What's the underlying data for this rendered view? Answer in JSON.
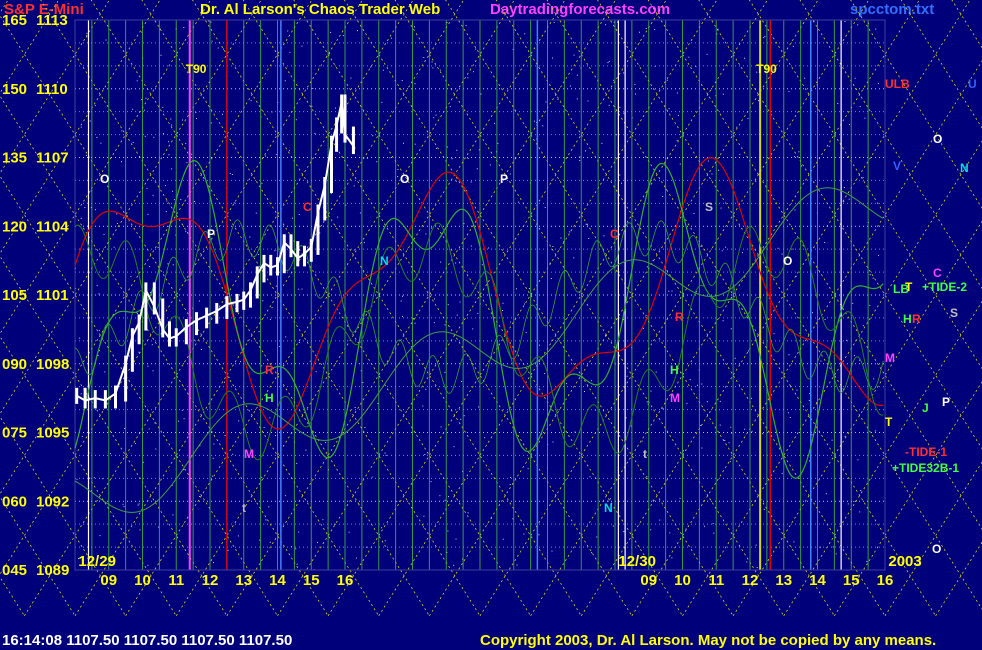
{
  "header": {
    "left_title": "S&P E-Mini",
    "center_title": "Dr. Al Larson's Chaos Trader Web",
    "site": "Daytradingforecasts.com",
    "filename": "spcctom.txt"
  },
  "footer": {
    "quote": "16:14:08  1107.50 1107.50 1107.50 1107.50",
    "copyright": "Copyright 2003, Dr. Al Larson. May not be copied by any means."
  },
  "colors": {
    "background": "#00007a",
    "axis_labels": "#ffff00",
    "price_bars": "#ffffff",
    "diagonal_grid": "#d8d800",
    "vertical_grid": "#40c040",
    "red_line": "#e00000",
    "green_line": "#30b030",
    "magenta_marker": "#ff40ff"
  },
  "chart_data": {
    "type": "line",
    "title": "S&P E-Mini",
    "y_axis_labels": [
      {
        "left": "165",
        "right": "1113",
        "value": 1113
      },
      {
        "left": "150",
        "right": "1110",
        "value": 1110
      },
      {
        "left": "135",
        "right": "1107",
        "value": 1107
      },
      {
        "left": "120",
        "right": "1104",
        "value": 1104
      },
      {
        "left": "105",
        "right": "1101",
        "value": 1101
      },
      {
        "left": "090",
        "right": "1098",
        "value": 1098
      },
      {
        "left": "075",
        "right": "1095",
        "value": 1095
      },
      {
        "left": "060",
        "right": "1092",
        "value": 1092
      },
      {
        "left": "045",
        "right": "1089",
        "value": 1089
      }
    ],
    "ylim": [
      1089,
      1113
    ],
    "date_labels": [
      {
        "text": "12/29",
        "hour": 8.1
      },
      {
        "text": "12/30",
        "hour": 24.1
      },
      {
        "text": "2003",
        "hour": 32.1
      }
    ],
    "x_ticks": [
      {
        "label": "09",
        "hour": 9
      },
      {
        "label": "10",
        "hour": 10
      },
      {
        "label": "11",
        "hour": 11
      },
      {
        "label": "12",
        "hour": 12
      },
      {
        "label": "13",
        "hour": 13
      },
      {
        "label": "14",
        "hour": 14
      },
      {
        "label": "15",
        "hour": 15
      },
      {
        "label": "16",
        "hour": 16
      },
      {
        "label": "09",
        "hour": 25
      },
      {
        "label": "10",
        "hour": 26
      },
      {
        "label": "11",
        "hour": 27
      },
      {
        "label": "12",
        "hour": 28
      },
      {
        "label": "13",
        "hour": 29
      },
      {
        "label": "14",
        "hour": 30
      },
      {
        "label": "15",
        "hour": 31
      },
      {
        "label": "16",
        "hour": 32
      }
    ],
    "xlim": [
      8.0,
      32.0
    ],
    "grid": true,
    "series": [
      {
        "name": "S&P E-Mini",
        "color": "#ffffff",
        "x": [
          8.05,
          8.3,
          8.6,
          8.9,
          9.2,
          9.5,
          9.7,
          9.9,
          10.1,
          10.35,
          10.6,
          10.8,
          11.0,
          11.3,
          11.6,
          11.9,
          12.2,
          12.5,
          12.8,
          13.0,
          13.2,
          13.4,
          13.6,
          13.8,
          14.0,
          14.2,
          14.4,
          14.6,
          14.8,
          15.0,
          15.2,
          15.4,
          15.6,
          15.75,
          15.9,
          16.0,
          16.25
        ],
        "values": [
          1096.6,
          1096.4,
          1096.5,
          1096.4,
          1096.7,
          1098.0,
          1099.2,
          1099.8,
          1101.2,
          1100.5,
          1099.5,
          1099.1,
          1099.2,
          1099.6,
          1099.9,
          1100.1,
          1100.3,
          1100.6,
          1100.7,
          1100.8,
          1101.2,
          1101.9,
          1102.4,
          1102.2,
          1102.3,
          1103.3,
          1103.0,
          1102.6,
          1102.8,
          1103.1,
          1104.6,
          1105.8,
          1107.6,
          1108.4,
          1109.4,
          1108.0,
          1107.5
        ]
      }
    ],
    "vertical_markers": [
      {
        "text": "T90",
        "hour": 11.4,
        "color": "#ff40ff"
      },
      {
        "text": "T90",
        "hour": 28.3,
        "color": "#d8d800"
      }
    ],
    "annotations": [
      {
        "text": "ULB",
        "color": "#ff3030"
      },
      {
        "text": "U",
        "color": "#3060ff"
      },
      {
        "text": "O",
        "color": "#ffffff"
      },
      {
        "text": "V",
        "color": "#3060ff"
      },
      {
        "text": "N",
        "color": "#00e0e0"
      },
      {
        "text": "C",
        "color": "#ff40ff"
      },
      {
        "text": "LB",
        "color": "#40ff40"
      },
      {
        "text": "T",
        "color": "#ffff00"
      },
      {
        "text": "+TIDE-2",
        "color": "#40ff40"
      },
      {
        "text": "H",
        "color": "#40ff40"
      },
      {
        "text": "R",
        "color": "#ff3030"
      },
      {
        "text": "S",
        "color": "#c0c0c0"
      },
      {
        "text": "M",
        "color": "#ff40ff"
      },
      {
        "text": "J",
        "color": "#40ff40"
      },
      {
        "text": "P",
        "color": "#ffffff"
      },
      {
        "text": "T",
        "color": "#ffff00"
      },
      {
        "text": "-TIDE-1",
        "color": "#ff3030"
      },
      {
        "text": "+TIDE32B-1",
        "color": "#40ff40"
      },
      {
        "text": "O",
        "color": "#ffffff"
      },
      {
        "text": "O",
        "color": "#ffffff"
      },
      {
        "text": "P",
        "color": "#ffffff"
      },
      {
        "text": "C",
        "color": "#ff3030"
      },
      {
        "text": "N",
        "color": "#00e0e0"
      },
      {
        "text": "H",
        "color": "#40ff40"
      },
      {
        "text": "R",
        "color": "#ff3030"
      },
      {
        "text": "M",
        "color": "#ff40ff"
      },
      {
        "text": "t",
        "color": "#c0c0c0"
      },
      {
        "text": "O",
        "color": "#ffffff"
      },
      {
        "text": "P",
        "color": "#ffffff"
      },
      {
        "text": "C",
        "color": "#ff3030"
      },
      {
        "text": "S",
        "color": "#c0c0c0"
      },
      {
        "text": "R",
        "color": "#ff3030"
      },
      {
        "text": "H",
        "color": "#40ff40"
      },
      {
        "text": "M",
        "color": "#ff40ff"
      },
      {
        "text": "t",
        "color": "#c0c0c0"
      },
      {
        "text": "N",
        "color": "#00e0e0"
      },
      {
        "text": "O",
        "color": "#ffffff"
      }
    ]
  }
}
